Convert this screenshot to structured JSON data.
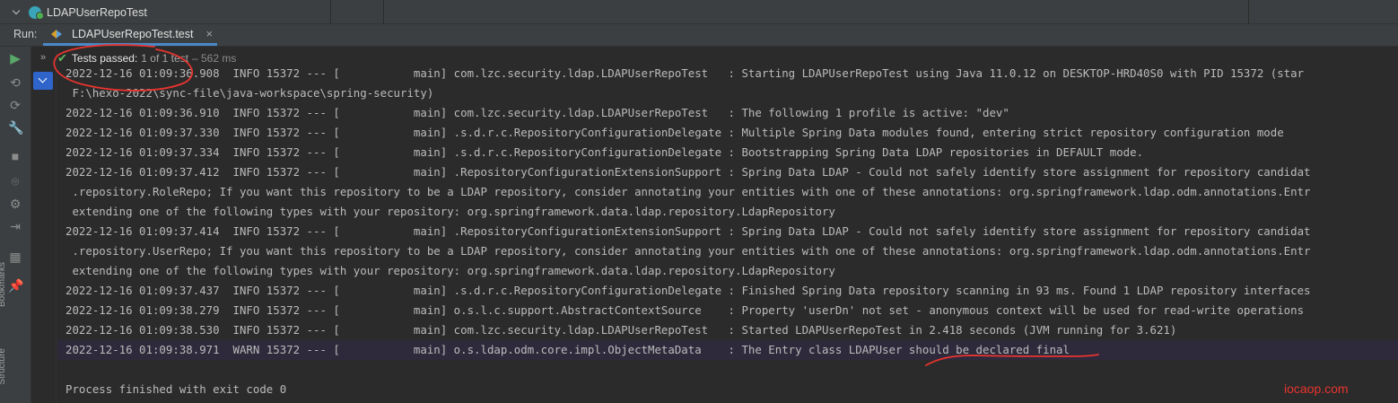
{
  "header": {
    "tree_item": "LDAPUserRepoTest"
  },
  "run_panel": {
    "label": "Run:",
    "tab_label": "LDAPUserRepoTest.test",
    "tab_close": "×",
    "sidebar_labels": [
      "Bookmarks",
      "Structure"
    ]
  },
  "status": {
    "passed_text": "Tests passed:",
    "count": "1 of 1 test",
    "duration": "– 562 ms",
    "collapse_glyph": "»"
  },
  "console": {
    "lines": [
      "2022-12-16 01:09:36.908  INFO 15372 --- [           main] com.lzc.security.ldap.LDAPUserRepoTest   : Starting LDAPUserRepoTest using Java 11.0.12 on DESKTOP-HRD40S0 with PID 15372 (star",
      " F:\\hexo-2022\\sync-file\\java-workspace\\spring-security)",
      "2022-12-16 01:09:36.910  INFO 15372 --- [           main] com.lzc.security.ldap.LDAPUserRepoTest   : The following 1 profile is active: \"dev\"",
      "2022-12-16 01:09:37.330  INFO 15372 --- [           main] .s.d.r.c.RepositoryConfigurationDelegate : Multiple Spring Data modules found, entering strict repository configuration mode",
      "2022-12-16 01:09:37.334  INFO 15372 --- [           main] .s.d.r.c.RepositoryConfigurationDelegate : Bootstrapping Spring Data LDAP repositories in DEFAULT mode.",
      "2022-12-16 01:09:37.412  INFO 15372 --- [           main] .RepositoryConfigurationExtensionSupport : Spring Data LDAP - Could not safely identify store assignment for repository candidat",
      " .repository.RoleRepo; If you want this repository to be a LDAP repository, consider annotating your entities with one of these annotations: org.springframework.ldap.odm.annotations.Entr",
      " extending one of the following types with your repository: org.springframework.data.ldap.repository.LdapRepository",
      "2022-12-16 01:09:37.414  INFO 15372 --- [           main] .RepositoryConfigurationExtensionSupport : Spring Data LDAP - Could not safely identify store assignment for repository candidat",
      " .repository.UserRepo; If you want this repository to be a LDAP repository, consider annotating your entities with one of these annotations: org.springframework.ldap.odm.annotations.Entr",
      " extending one of the following types with your repository: org.springframework.data.ldap.repository.LdapRepository",
      "2022-12-16 01:09:37.437  INFO 15372 --- [           main] .s.d.r.c.RepositoryConfigurationDelegate : Finished Spring Data repository scanning in 93 ms. Found 1 LDAP repository interfaces",
      "2022-12-16 01:09:38.279  INFO 15372 --- [           main] o.s.l.c.support.AbstractContextSource    : Property 'userDn' not set - anonymous context will be used for read-write operations",
      "2022-12-16 01:09:38.530  INFO 15372 --- [           main] com.lzc.security.ldap.LDAPUserRepoTest   : Started LDAPUserRepoTest in 2.418 seconds (JVM running for 3.621)",
      "2022-12-16 01:09:38.971  WARN 15372 --- [           main] o.s.ldap.odm.core.impl.ObjectMetaData    : The Entry class LDAPUser should be declared final",
      "",
      "Process finished with exit code 0"
    ]
  },
  "watermark": "iocaop.com",
  "colors": {
    "background": "#2b2b2b",
    "toolbar": "#3c3f41",
    "accent_blue": "#4a88c7",
    "pass_green": "#5fb85f",
    "annotation_red": "#e8342e",
    "warn_highlight": "#2e2a3c"
  }
}
